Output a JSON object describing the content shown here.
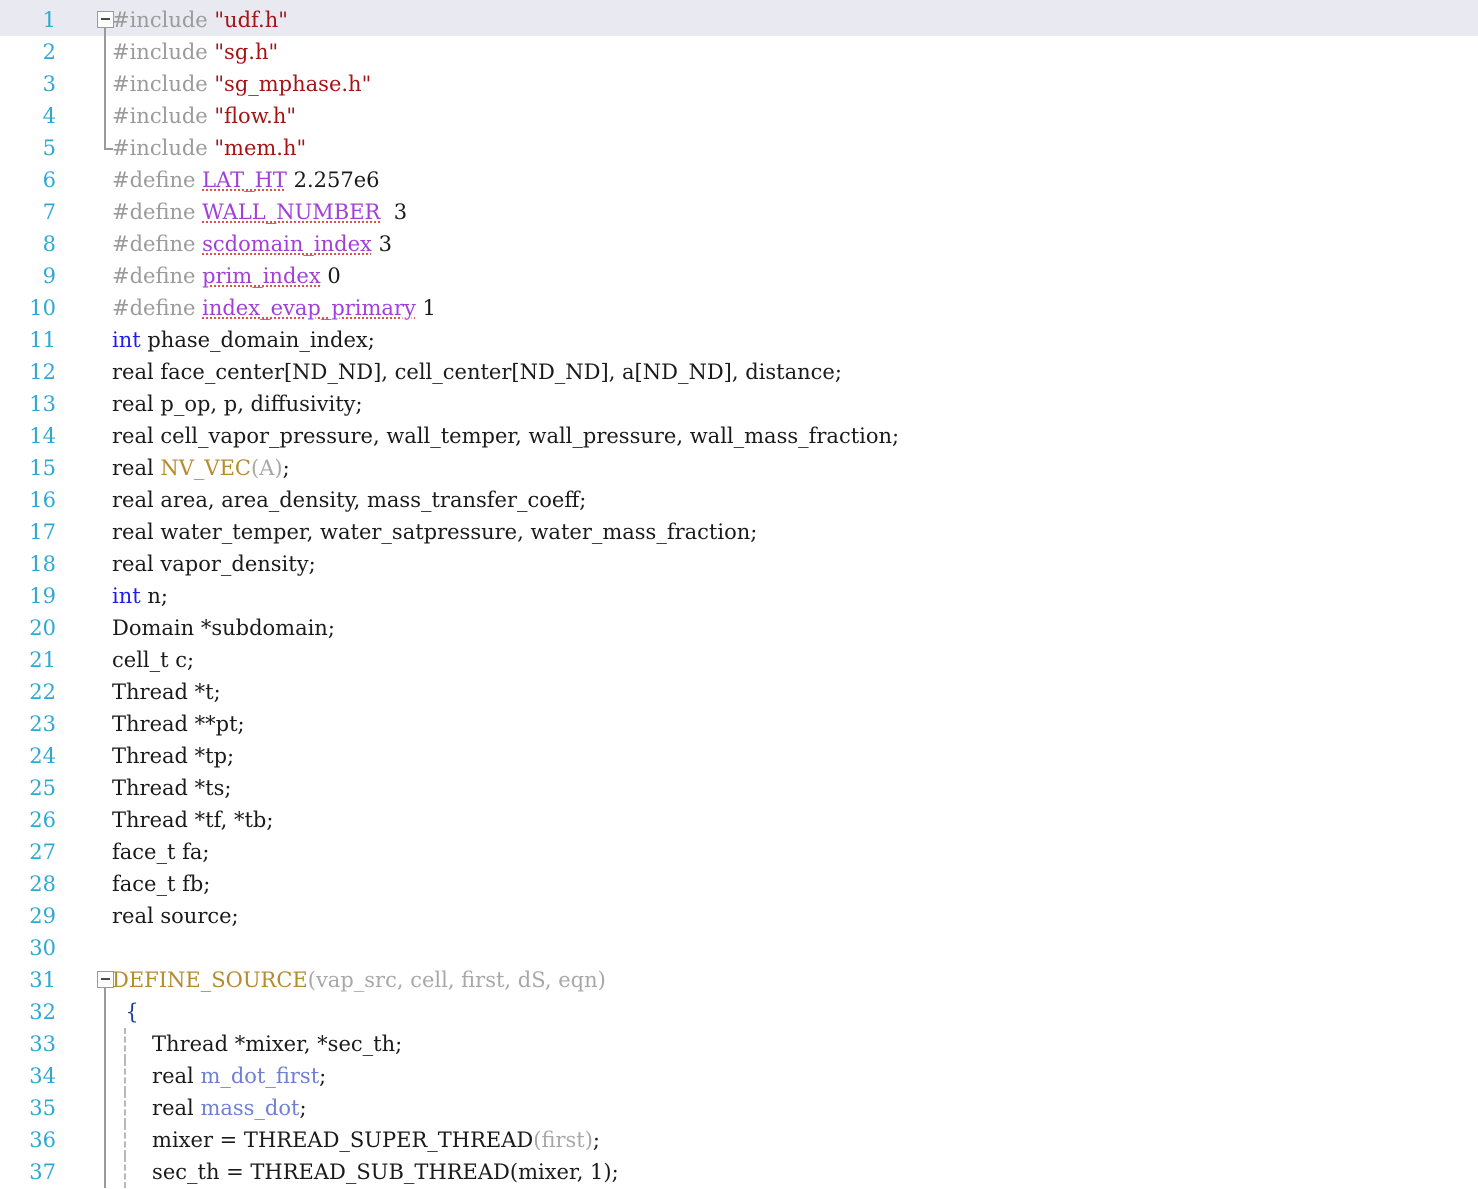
{
  "editor": {
    "name": "code-editor",
    "language": "C",
    "font_size_px": 21,
    "line_height_px": 32,
    "current_line": 1,
    "first_visible_line": 1,
    "last_visible_line": 37,
    "colors": {
      "background": "#ffffff",
      "gutter_number": "#2fa8d4",
      "current_line_highlight": "#e9e9f2",
      "preprocessor": "#9b9b9b",
      "string": "#a31515",
      "macro_name": "#a13fd8",
      "keyword": "#1d1df0",
      "plain_text": "#1a1a1a",
      "macro_function": "#b58b2e",
      "macro_argument": "#a8a8a8",
      "local_variable": "#6f7fd6",
      "brace": "#1f3fa0",
      "fold_marker": "#9a9a9a",
      "indent_guide": "#b8b8b8",
      "spell_underline": "#e0504a"
    },
    "fold_markers": [
      {
        "line": 1,
        "state": "expanded",
        "glyph": "minus"
      },
      {
        "line": 31,
        "state": "expanded",
        "glyph": "minus"
      }
    ]
  },
  "lines": [
    {
      "n": "1",
      "current": true,
      "fold": "box",
      "indent": false,
      "tokens": [
        {
          "c": "t-pp",
          "t": "#include "
        },
        {
          "c": "t-str",
          "t": "\"udf.h\""
        }
      ]
    },
    {
      "n": "2",
      "current": false,
      "fold": "bar",
      "indent": false,
      "tokens": [
        {
          "c": "t-pp",
          "t": "#include "
        },
        {
          "c": "t-str",
          "t": "\"sg.h\""
        }
      ]
    },
    {
      "n": "3",
      "current": false,
      "fold": "bar",
      "indent": false,
      "tokens": [
        {
          "c": "t-pp",
          "t": "#include "
        },
        {
          "c": "t-str",
          "t": "\"sg_mphase.h\""
        }
      ]
    },
    {
      "n": "4",
      "current": false,
      "fold": "bar",
      "indent": false,
      "tokens": [
        {
          "c": "t-pp",
          "t": "#include "
        },
        {
          "c": "t-str",
          "t": "\"flow.h\""
        }
      ]
    },
    {
      "n": "5",
      "current": false,
      "fold": "end",
      "indent": false,
      "tokens": [
        {
          "c": "t-pp",
          "t": "#include "
        },
        {
          "c": "t-str",
          "t": "\"mem.h\""
        }
      ]
    },
    {
      "n": "6",
      "current": false,
      "fold": "none",
      "indent": false,
      "tokens": [
        {
          "c": "t-pp",
          "t": "#define "
        },
        {
          "c": "t-spell",
          "t": "LAT_HT"
        },
        {
          "c": "t-plain",
          "t": " "
        },
        {
          "c": "t-num",
          "t": "2.257e6"
        }
      ]
    },
    {
      "n": "7",
      "current": false,
      "fold": "none",
      "indent": false,
      "tokens": [
        {
          "c": "t-pp",
          "t": "#define "
        },
        {
          "c": "t-spell",
          "t": "WALL_NUMBER"
        },
        {
          "c": "t-plain",
          "t": "  "
        },
        {
          "c": "t-num",
          "t": "3"
        }
      ]
    },
    {
      "n": "8",
      "current": false,
      "fold": "none",
      "indent": false,
      "tokens": [
        {
          "c": "t-pp",
          "t": "#define "
        },
        {
          "c": "t-spell",
          "t": "scdomain_index"
        },
        {
          "c": "t-plain",
          "t": " "
        },
        {
          "c": "t-num",
          "t": "3"
        }
      ]
    },
    {
      "n": "9",
      "current": false,
      "fold": "none",
      "indent": false,
      "tokens": [
        {
          "c": "t-pp",
          "t": "#define "
        },
        {
          "c": "t-spell",
          "t": "prim_index"
        },
        {
          "c": "t-plain",
          "t": " "
        },
        {
          "c": "t-num",
          "t": "0"
        }
      ]
    },
    {
      "n": "10",
      "current": false,
      "fold": "none",
      "indent": false,
      "tokens": [
        {
          "c": "t-pp",
          "t": "#define "
        },
        {
          "c": "t-spell",
          "t": "index_evap_primary"
        },
        {
          "c": "t-plain",
          "t": " "
        },
        {
          "c": "t-num",
          "t": "1"
        }
      ]
    },
    {
      "n": "11",
      "current": false,
      "fold": "none",
      "indent": false,
      "tokens": [
        {
          "c": "t-kw",
          "t": "int"
        },
        {
          "c": "t-plain",
          "t": " phase_domain_index;"
        }
      ]
    },
    {
      "n": "12",
      "current": false,
      "fold": "none",
      "indent": false,
      "tokens": [
        {
          "c": "t-plain",
          "t": "real face_center[ND_ND], cell_center[ND_ND], a[ND_ND], distance;"
        }
      ]
    },
    {
      "n": "13",
      "current": false,
      "fold": "none",
      "indent": false,
      "tokens": [
        {
          "c": "t-plain",
          "t": "real p_op, p, diffusivity;"
        }
      ]
    },
    {
      "n": "14",
      "current": false,
      "fold": "none",
      "indent": false,
      "tokens": [
        {
          "c": "t-plain",
          "t": "real cell_vapor_pressure, wall_temper, wall_pressure, wall_mass_fraction;"
        }
      ]
    },
    {
      "n": "15",
      "current": false,
      "fold": "none",
      "indent": false,
      "tokens": [
        {
          "c": "t-plain",
          "t": "real "
        },
        {
          "c": "t-func",
          "t": "NV_VEC"
        },
        {
          "c": "t-param",
          "t": "("
        },
        {
          "c": "t-param",
          "t": "A"
        },
        {
          "c": "t-param",
          "t": ")"
        },
        {
          "c": "t-plain",
          "t": ";"
        }
      ]
    },
    {
      "n": "16",
      "current": false,
      "fold": "none",
      "indent": false,
      "tokens": [
        {
          "c": "t-plain",
          "t": "real area, area_density, mass_transfer_coeff;"
        }
      ]
    },
    {
      "n": "17",
      "current": false,
      "fold": "none",
      "indent": false,
      "tokens": [
        {
          "c": "t-plain",
          "t": "real water_temper, water_satpressure, water_mass_fraction;"
        }
      ]
    },
    {
      "n": "18",
      "current": false,
      "fold": "none",
      "indent": false,
      "tokens": [
        {
          "c": "t-plain",
          "t": "real vapor_density;"
        }
      ]
    },
    {
      "n": "19",
      "current": false,
      "fold": "none",
      "indent": false,
      "tokens": [
        {
          "c": "t-kw",
          "t": "int"
        },
        {
          "c": "t-plain",
          "t": " n;"
        }
      ]
    },
    {
      "n": "20",
      "current": false,
      "fold": "none",
      "indent": false,
      "tokens": [
        {
          "c": "t-plain",
          "t": "Domain *subdomain;"
        }
      ]
    },
    {
      "n": "21",
      "current": false,
      "fold": "none",
      "indent": false,
      "tokens": [
        {
          "c": "t-plain",
          "t": "cell_t c;"
        }
      ]
    },
    {
      "n": "22",
      "current": false,
      "fold": "none",
      "indent": false,
      "tokens": [
        {
          "c": "t-plain",
          "t": "Thread *t;"
        }
      ]
    },
    {
      "n": "23",
      "current": false,
      "fold": "none",
      "indent": false,
      "tokens": [
        {
          "c": "t-plain",
          "t": "Thread **pt;"
        }
      ]
    },
    {
      "n": "24",
      "current": false,
      "fold": "none",
      "indent": false,
      "tokens": [
        {
          "c": "t-plain",
          "t": "Thread *tp;"
        }
      ]
    },
    {
      "n": "25",
      "current": false,
      "fold": "none",
      "indent": false,
      "tokens": [
        {
          "c": "t-plain",
          "t": "Thread *ts;"
        }
      ]
    },
    {
      "n": "26",
      "current": false,
      "fold": "none",
      "indent": false,
      "tokens": [
        {
          "c": "t-plain",
          "t": "Thread *tf, *tb;"
        }
      ]
    },
    {
      "n": "27",
      "current": false,
      "fold": "none",
      "indent": false,
      "tokens": [
        {
          "c": "t-plain",
          "t": "face_t fa;"
        }
      ]
    },
    {
      "n": "28",
      "current": false,
      "fold": "none",
      "indent": false,
      "tokens": [
        {
          "c": "t-plain",
          "t": "face_t fb;"
        }
      ]
    },
    {
      "n": "29",
      "current": false,
      "fold": "none",
      "indent": false,
      "tokens": [
        {
          "c": "t-plain",
          "t": "real source;"
        }
      ]
    },
    {
      "n": "30",
      "current": false,
      "fold": "none",
      "indent": false,
      "tokens": []
    },
    {
      "n": "31",
      "current": false,
      "fold": "box",
      "indent": false,
      "tokens": [
        {
          "c": "t-func",
          "t": "DEFINE_SOURCE"
        },
        {
          "c": "t-param",
          "t": "(vap_src, cell, first, dS, eqn)"
        }
      ]
    },
    {
      "n": "32",
      "current": false,
      "fold": "bar",
      "indent": false,
      "tokens": [
        {
          "c": "t-brace",
          "t": "  {"
        }
      ]
    },
    {
      "n": "33",
      "current": false,
      "fold": "bar",
      "indent": true,
      "tokens": [
        {
          "c": "t-plain",
          "t": "      Thread *mixer, *sec_th;"
        }
      ]
    },
    {
      "n": "34",
      "current": false,
      "fold": "bar",
      "indent": true,
      "tokens": [
        {
          "c": "t-plain",
          "t": "      real "
        },
        {
          "c": "t-var",
          "t": "m_dot_first"
        },
        {
          "c": "t-plain",
          "t": ";"
        }
      ]
    },
    {
      "n": "35",
      "current": false,
      "fold": "bar",
      "indent": true,
      "tokens": [
        {
          "c": "t-plain",
          "t": "      real "
        },
        {
          "c": "t-var",
          "t": "mass_dot"
        },
        {
          "c": "t-plain",
          "t": ";"
        }
      ]
    },
    {
      "n": "36",
      "current": false,
      "fold": "bar",
      "indent": true,
      "tokens": [
        {
          "c": "t-plain",
          "t": "      mixer = THREAD_SUPER_THREAD"
        },
        {
          "c": "t-param",
          "t": "("
        },
        {
          "c": "t-param",
          "t": "first"
        },
        {
          "c": "t-param",
          "t": ")"
        },
        {
          "c": "t-plain",
          "t": ";"
        }
      ]
    },
    {
      "n": "37",
      "current": false,
      "fold": "bar",
      "indent": true,
      "tokens": [
        {
          "c": "t-plain",
          "t": "      sec_th = THREAD_SUB_THREAD(mixer, 1);"
        }
      ]
    }
  ]
}
